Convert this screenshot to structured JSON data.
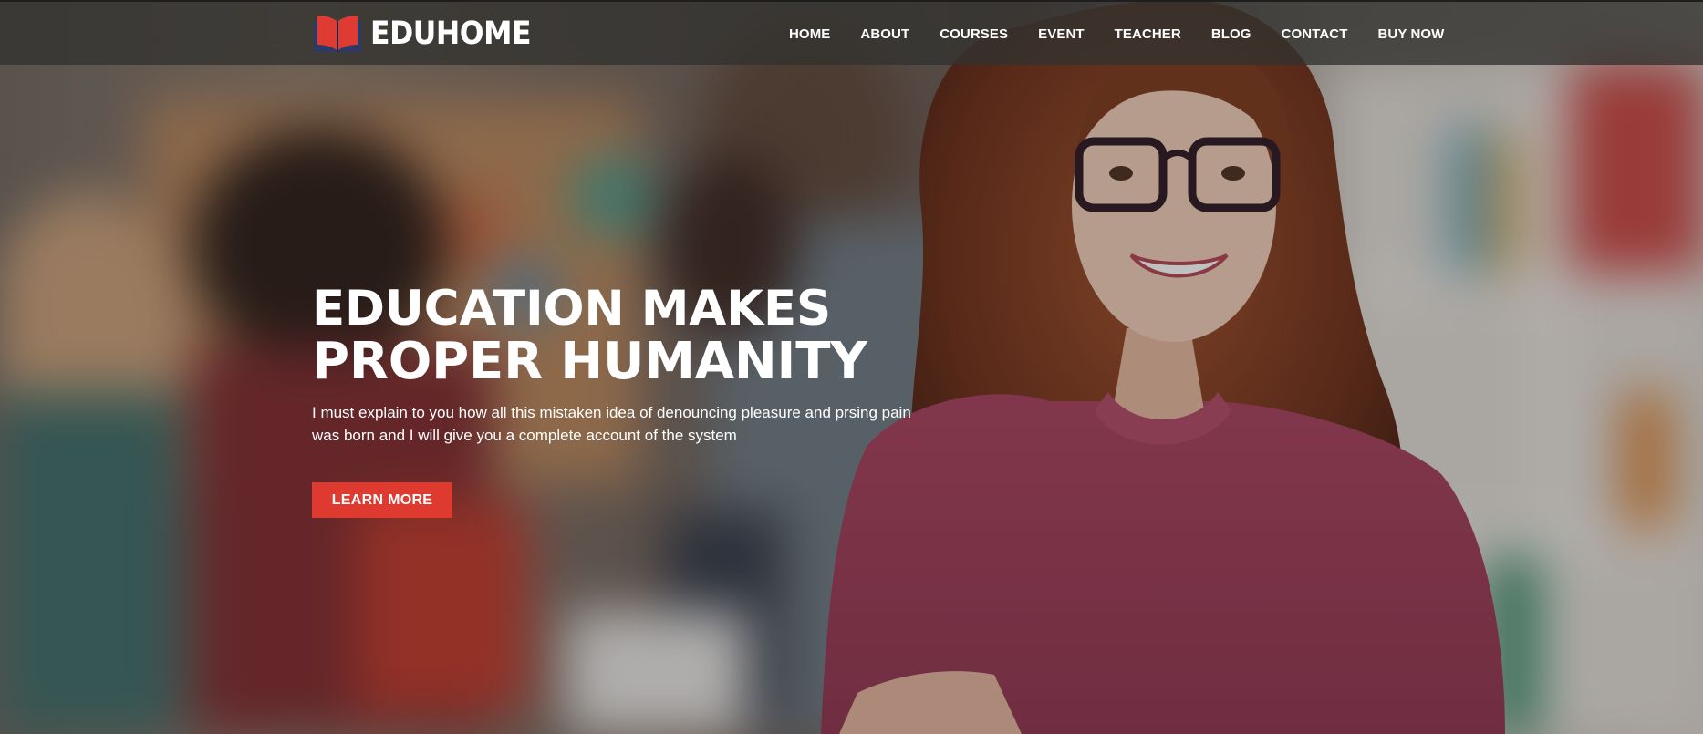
{
  "header": {
    "brand": "EDUHOME",
    "logo_icon": "open-book-icon",
    "nav": [
      {
        "label": "HOME"
      },
      {
        "label": "ABOUT"
      },
      {
        "label": "COURSES"
      },
      {
        "label": "EVENT"
      },
      {
        "label": "TEACHER"
      },
      {
        "label": "BLOG"
      },
      {
        "label": "CONTACT"
      },
      {
        "label": "BUY NOW"
      }
    ]
  },
  "hero": {
    "title_line1": "EDUCATION MAKES",
    "title_line2": "PROPER HUMANITY",
    "description": "I must explain to you how all this mistaken idea of denouncing pleasure and prsing pain was born and I will give you a complete account of the system",
    "cta_label": "LEARN MORE"
  },
  "colors": {
    "accent": "#de3a2f",
    "header_bg": "#323230",
    "text": "#ffffff"
  }
}
